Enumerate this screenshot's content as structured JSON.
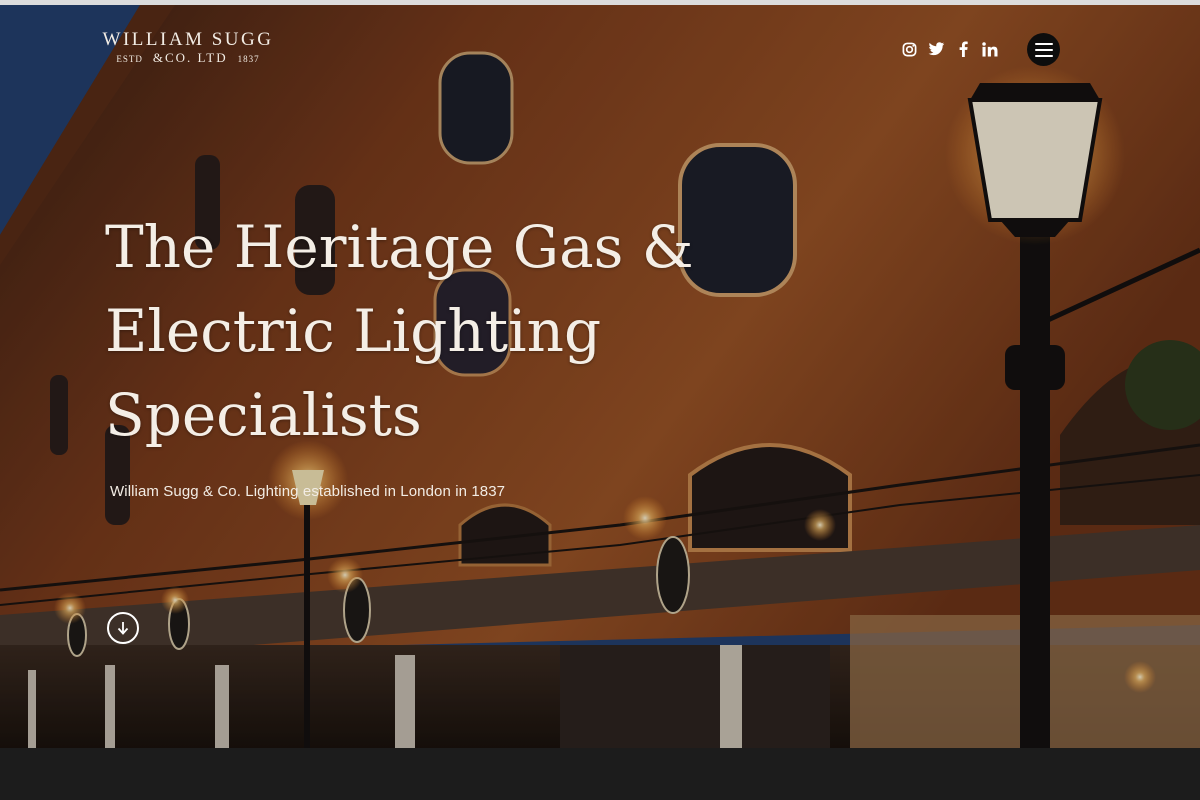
{
  "header": {
    "logo": {
      "line1": "WILLIAM SUGG",
      "estd": "ESTD",
      "company": "&CO. LTD",
      "year": "1837"
    },
    "social_icons": [
      "instagram-icon",
      "twitter-icon",
      "facebook-icon",
      "linkedin-icon"
    ],
    "menu_icon": "hamburger-menu-icon"
  },
  "hero": {
    "headline_line1": "The Heritage Gas &",
    "headline_line2": "Electric Lighting",
    "headline_line3": "Specialists",
    "subtitle": "William Sugg & Co. Lighting established in London in 1837",
    "scroll_icon": "arrow-down-icon"
  },
  "colors": {
    "text": "#f4eee6",
    "menu_button": "#0d0d0d",
    "footer_bar": "#1c1c1c",
    "brick": "#8a4a24"
  }
}
